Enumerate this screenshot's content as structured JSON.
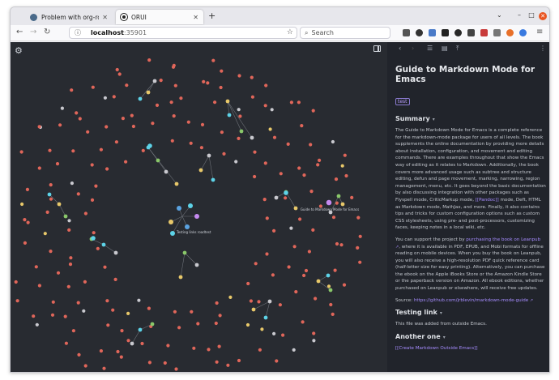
{
  "browser": {
    "tabs": [
      {
        "title": "Problem with org-roam-",
        "active": false
      },
      {
        "title": "ORUI",
        "active": true
      }
    ],
    "url": {
      "host": "localhost",
      "port": ":35901"
    },
    "search_placeholder": "Search"
  },
  "graph": {
    "labels": [
      "Guide to Markdown Mode for Emacs",
      "Testing links roadtest"
    ],
    "colors": {
      "background": "#282b31",
      "orphan_node": "#e0665a",
      "tag_node": "#e8c86a",
      "linked_node": "#c9c9cf",
      "cyan_node": "#5dd3e8",
      "green_node": "#8ac86a",
      "purple_node": "#c58af0",
      "blue_node": "#5aa2e0",
      "edge": "#6d7178"
    }
  },
  "panel": {
    "title": "Guide to Markdown Mode for Emacs",
    "tag": "test",
    "summary_heading": "Summary",
    "summary_p1_a": "The Guide to Markdown Mode for Emacs is a complete reference for the markdown-mode package for users of all levels. The book supplements the online documentation by providing more details about installation, configuration, and movement and editing commands. There are examples throughout that show the Emacs way of editing as it relates to Markdown. Additionally, the book covers more advanced usage such as subtree and structure editing, defun and page movement, marking, narrowing, region management, menu, etc. It goes beyond the basic documentation by also discussing integration with other packages such as Flyspell mode, CriticMarkup mode, ",
    "summary_p1_link": "[[Pandoc]]",
    "summary_p1_b": " mode, Deft, HTML as Markdown mode, MathJax, and more. Finally, it also contains tips and tricks for custom configuration options such as custom CSS stylesheets, using pre- and post-processors, customizing faces, keeping notes in a local wiki, etc.",
    "summary_p2_a": "You can support the project by ",
    "summary_p2_link": "purchasing the book on Leanpub",
    "summary_p2_b": ", where it is available in PDF, EPUB, and Mobi formats for offline reading on mobile devices. When you buy the book on Leanpub, you will also receive a high-resolution PDF quick reference card (half-letter size for easy printing). Alternatively, you can purchase the ebook on the Apple iBooks Store or the Amazon Kindle Store or the paperback version on Amazon. All ebook editions, whether purchased on Leanpub or elsewhere, will receive free updates.",
    "source_label": "Source: ",
    "source_link": "https://github.com/jrblevin/markdown-mode-guide",
    "testing_heading": "Testing link",
    "testing_text": "This file was added from outside Emacs.",
    "another_heading": "Another one",
    "another_link": "[[Create Markdown Outside Emacs]]"
  }
}
